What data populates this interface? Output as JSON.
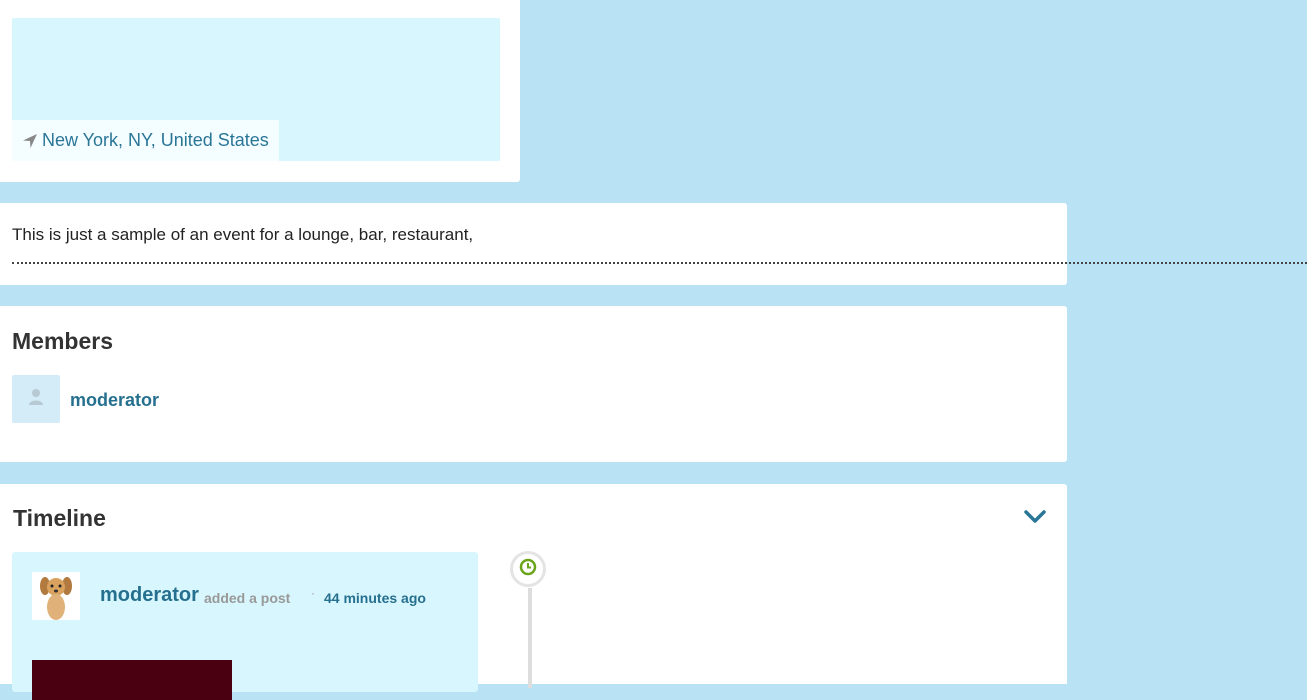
{
  "location": {
    "label": "New York, NY, United States",
    "icon": "location-arrow-icon"
  },
  "description": {
    "text": "This is just a sample of an event for a lounge, bar, restaurant,"
  },
  "members": {
    "title": "Members",
    "items": [
      {
        "name": "moderator",
        "avatar_icon": "user-icon"
      }
    ]
  },
  "timeline": {
    "title": "Timeline",
    "collapse_icon": "chevron-down-icon",
    "posts": [
      {
        "author": "moderator",
        "action": "added a post",
        "separator": "·",
        "time": "44 minutes ago",
        "node_icon": "clock-icon"
      }
    ]
  },
  "colors": {
    "page_background": "#b9e2f5",
    "card_background": "#ffffff",
    "map_background": "#d8f6fd",
    "link": "#26708f",
    "clock_accent": "#6aa51c"
  }
}
